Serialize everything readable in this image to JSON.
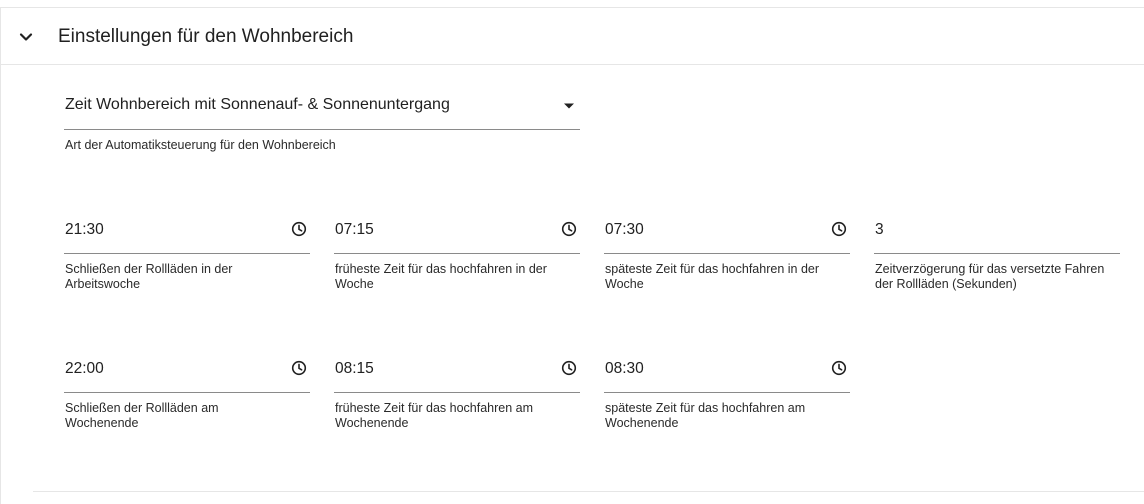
{
  "section": {
    "title": "Einstellungen für den Wohnbereich",
    "chevron_icon": "chevron-down-icon"
  },
  "mode": {
    "value": "Zeit Wohnbereich mit Sonnenauf- & Sonnenuntergang",
    "helper": "Art der Automatiksteuerung für den Wohnbereich"
  },
  "fields": {
    "close_week": {
      "value": "21:30",
      "label": "Schließen der Rollläden in der Arbeitswoche"
    },
    "earliest_week": {
      "value": "07:15",
      "label": "früheste Zeit für das hochfahren in der Woche"
    },
    "latest_week": {
      "value": "07:30",
      "label": "späteste Zeit für das hochfahren in der Woche"
    },
    "delay": {
      "value": "3",
      "label": "Zeitverzögerung für das versetzte Fahren der Rollläden (Sekunden)"
    },
    "close_weekend": {
      "value": "22:00",
      "label": "Schließen der Rollläden am Wochenende"
    },
    "earliest_weekend": {
      "value": "08:15",
      "label": "früheste Zeit für das hochfahren am Wochenende"
    },
    "latest_weekend": {
      "value": "08:30",
      "label": "späteste Zeit für das hochfahren am Wochenende"
    }
  },
  "colors": {
    "text": "#212121",
    "underline": "#8a8a8a",
    "divider": "#e6e6e6"
  }
}
